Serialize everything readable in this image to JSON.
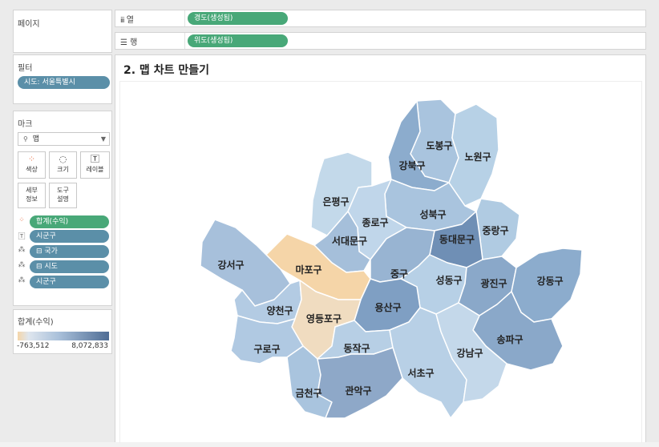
{
  "left_panel": {
    "pages_title": "페이지",
    "filters_title": "필터",
    "filter_pill": "시도: 서울특별시",
    "marks_title": "마크",
    "mark_type": "맵",
    "mark_type_icon": "map-pin-icon",
    "buttons": {
      "color": "색상",
      "size": "크기",
      "label": "레이블",
      "detail_line1": "세부",
      "detail_line2": "정보",
      "tooltip_line1": "도구",
      "tooltip_line2": "설명"
    },
    "mark_fields": [
      "합계(수익)",
      "시군구",
      "⊟ 국가",
      "⊟ 시도",
      "시군구"
    ],
    "legend_title": "합계(수익)",
    "legend_min": "-763,512",
    "legend_max": "8,072,833",
    "legend_colors": {
      "low": "#f5d5a8",
      "mid": "#dfe6ee",
      "high": "#4e6c94"
    }
  },
  "shelves": {
    "columns_label": "열",
    "columns_pill": "경도(생성됨)",
    "rows_label": "행",
    "rows_pill": "위도(생성됨)"
  },
  "viz": {
    "title": "2. 맵 차트 만들기",
    "districts": [
      {
        "name": "도봉구",
        "color": "#a9c4de"
      },
      {
        "name": "노원구",
        "color": "#b7d1e6"
      },
      {
        "name": "강북구",
        "color": "#8caccd"
      },
      {
        "name": "은평구",
        "color": "#c3d9ea"
      },
      {
        "name": "성북구",
        "color": "#a9c4de"
      },
      {
        "name": "종로구",
        "color": "#c0d6ea"
      },
      {
        "name": "중랑구",
        "color": "#b0cbe2"
      },
      {
        "name": "동대문구",
        "color": "#6f8fb5"
      },
      {
        "name": "서대문구",
        "color": "#a5bfda"
      },
      {
        "name": "마포구",
        "color": "#f5d5a8"
      },
      {
        "name": "강서구",
        "color": "#a7c0db"
      },
      {
        "name": "중구",
        "color": "#98b4d2"
      },
      {
        "name": "성동구",
        "color": "#b7d0e6"
      },
      {
        "name": "광진구",
        "color": "#8aa8c9"
      },
      {
        "name": "강동구",
        "color": "#8caccd"
      },
      {
        "name": "용산구",
        "color": "#7f9fc3"
      },
      {
        "name": "양천구",
        "color": "#b3cbe3"
      },
      {
        "name": "영등포구",
        "color": "#f0dcc0"
      },
      {
        "name": "구로구",
        "color": "#b0c9e2"
      },
      {
        "name": "동작구",
        "color": "#b7cfe5"
      },
      {
        "name": "송파구",
        "color": "#8aa8c9"
      },
      {
        "name": "서초구",
        "color": "#b8d0e6"
      },
      {
        "name": "강남구",
        "color": "#c4d8ea"
      },
      {
        "name": "금천구",
        "color": "#a9c4de"
      },
      {
        "name": "관악구",
        "color": "#8ea8c8"
      }
    ]
  }
}
